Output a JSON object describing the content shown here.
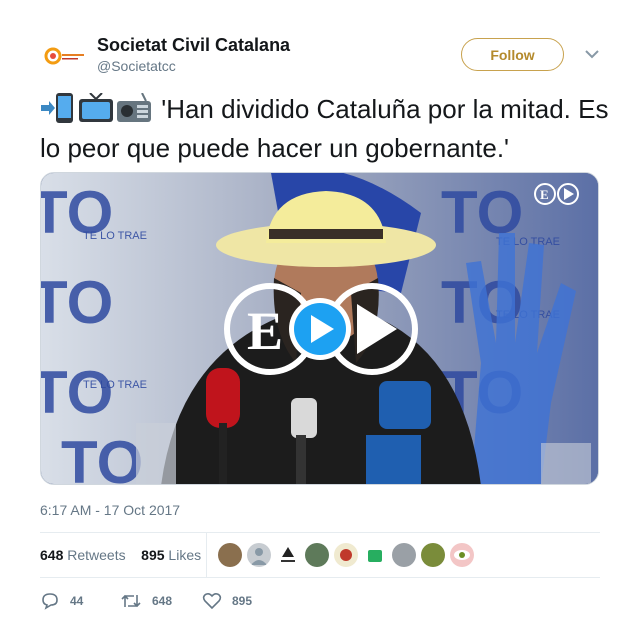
{
  "account": {
    "name": "Societat Civil Catalana",
    "handle": "@Societatcc",
    "follow_label": "Follow"
  },
  "tweet": {
    "text": "'Han dividido Cataluña por la mitad. Es lo peor que puede hacer un gobernante.'",
    "emojis": [
      "mobile-arrow-icon",
      "tv-icon",
      "radio-icon"
    ]
  },
  "media": {
    "kind": "video",
    "logo_text": "E",
    "banner_text": "TE LO TRAE"
  },
  "timestamp": "6:17 AM - 17 Oct 2017",
  "stats": {
    "retweets_count": "648",
    "retweets_label": "Retweets",
    "likes_count": "895",
    "likes_label": "Likes"
  },
  "likers_count": 9,
  "actions": {
    "replies": "44",
    "retweets": "648",
    "likes": "895"
  },
  "colors": {
    "follow_border": "#c8a24e",
    "play_button": "#1da1f2",
    "muted_text": "#657786"
  }
}
